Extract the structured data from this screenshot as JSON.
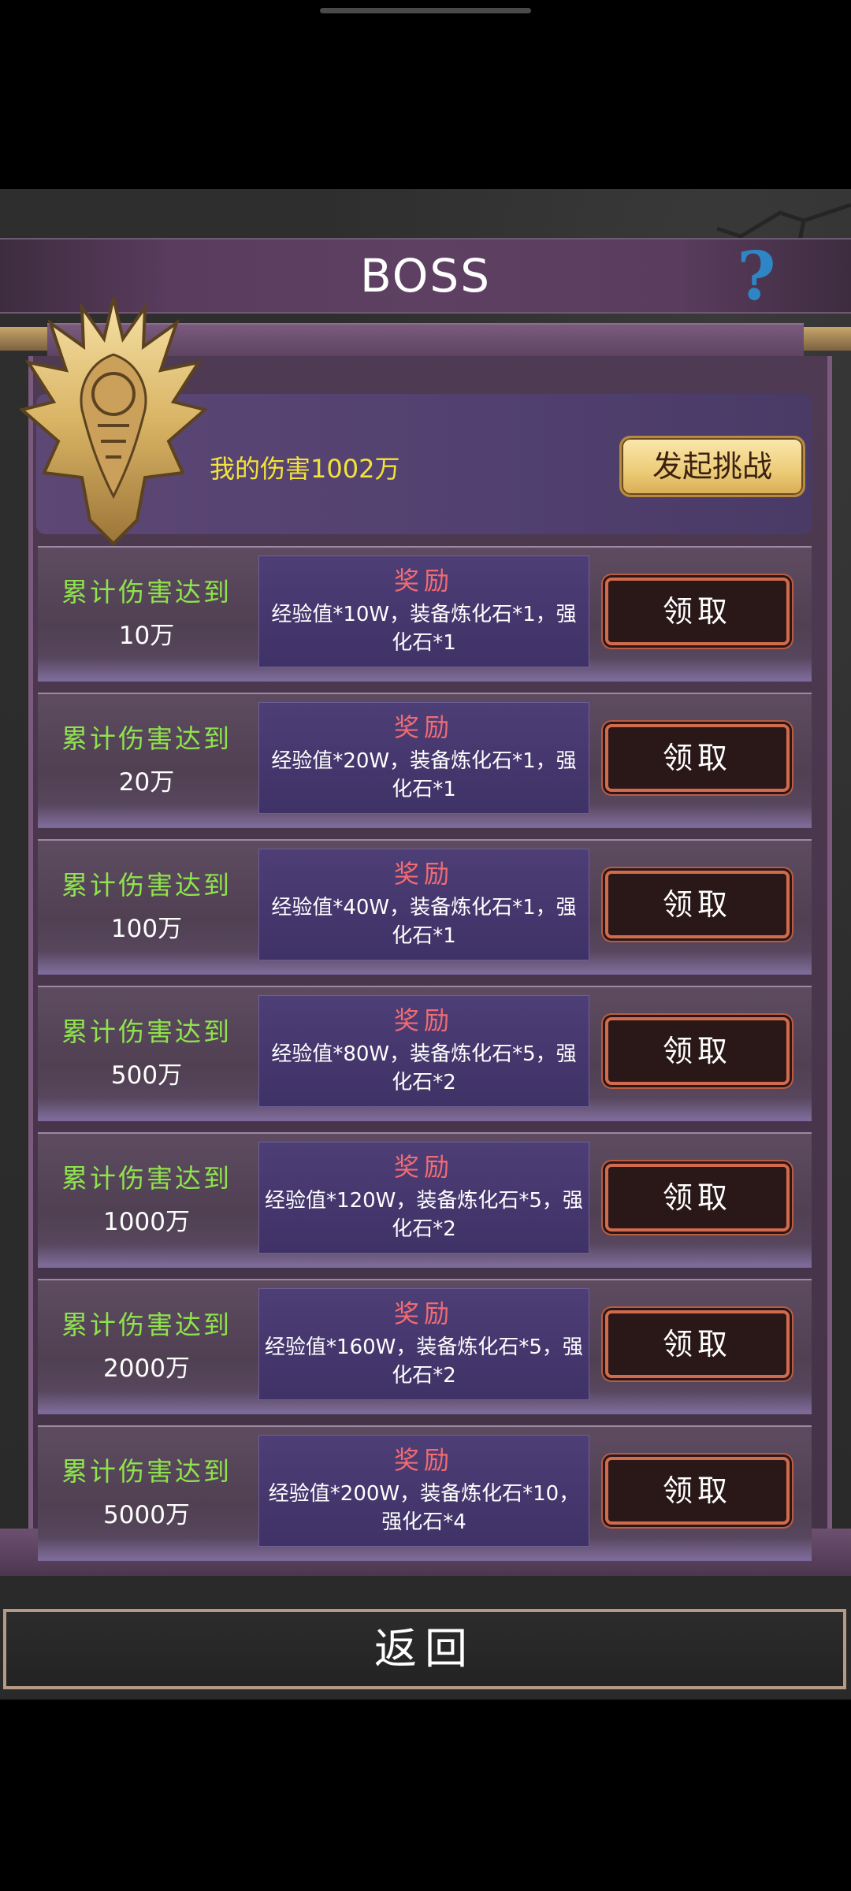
{
  "header": {
    "title": "BOSS"
  },
  "my_damage": {
    "label": "我的伤害1002万"
  },
  "challenge_button": {
    "label": "发起挑战"
  },
  "reward_label": "奖励",
  "claim_label": "领取",
  "condition_label": "累计伤害达到",
  "rows": [
    {
      "amount": "10万",
      "reward": "经验值*10W，装备炼化石*1，强化石*1"
    },
    {
      "amount": "20万",
      "reward": "经验值*20W，装备炼化石*1，强化石*1"
    },
    {
      "amount": "100万",
      "reward": "经验值*40W，装备炼化石*1，强化石*1"
    },
    {
      "amount": "500万",
      "reward": "经验值*80W，装备炼化石*5，强化石*2"
    },
    {
      "amount": "1000万",
      "reward": "经验值*120W，装备炼化石*5，强化石*2"
    },
    {
      "amount": "2000万",
      "reward": "经验值*160W，装备炼化石*5，强化石*2"
    },
    {
      "amount": "5000万",
      "reward": "经验值*200W，装备炼化石*10，强化石*4"
    }
  ],
  "back_button": {
    "label": "返回"
  },
  "icons": {
    "help": "question-mark-icon",
    "emblem": "dragon-emblem-icon"
  },
  "colors": {
    "condition": "#8ee34d",
    "reward_title": "#f06b73",
    "my_damage": "#f2e33a",
    "help": "#2f86c7"
  }
}
